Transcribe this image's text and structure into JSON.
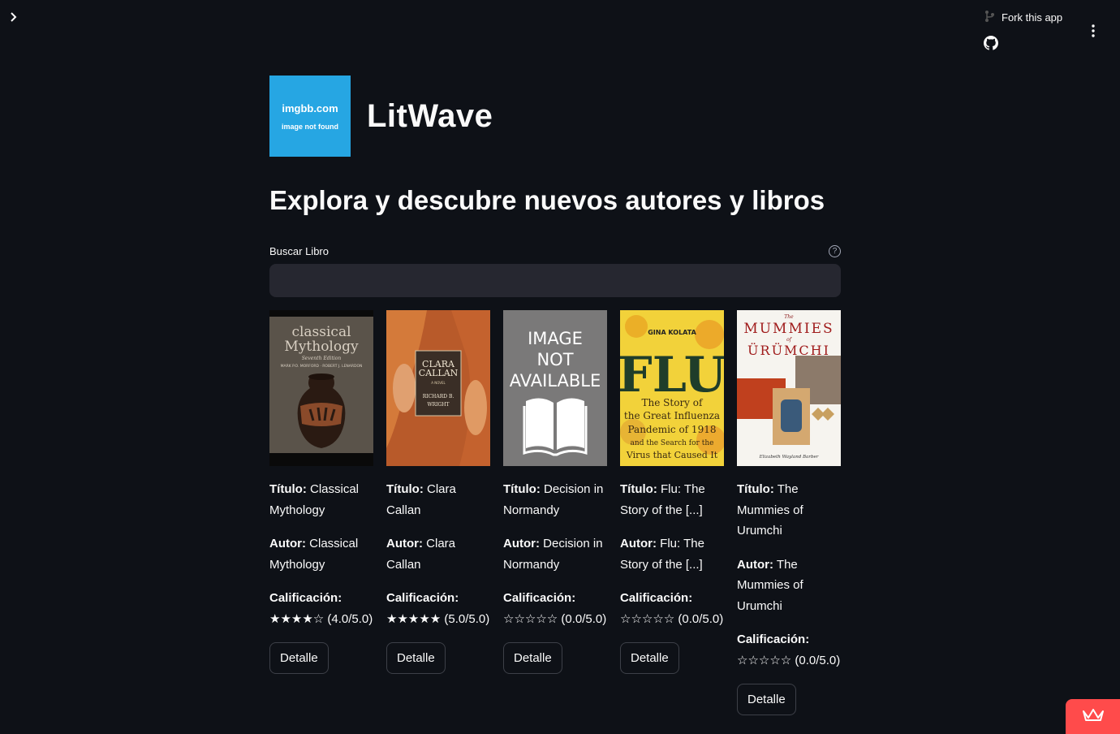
{
  "header": {
    "fork_label": "Fork this app"
  },
  "logo": {
    "line1": "imgbb.com",
    "line2": "image not found"
  },
  "app_title": "LitWave",
  "subtitle": "Explora y descubre nuevos autores y libros",
  "search": {
    "label": "Buscar Libro",
    "value": "",
    "placeholder": ""
  },
  "labels": {
    "title": "Título:",
    "author": "Autor:",
    "rating": "Calificación:",
    "detail": "Detalle"
  },
  "books": [
    {
      "title": "Classical Mythology",
      "author": "Classical Mythology",
      "rating_text": "★★★★☆ (4.0/5.0)",
      "rating": 4.0,
      "cover_text": [
        "classical",
        "Mythology",
        "Seventh Edition",
        "MARK P.O. MORFORD · ROBERT J. LENARDON"
      ]
    },
    {
      "title": "Clara Callan",
      "author": "Clara Callan",
      "rating_text": "★★★★★ (5.0/5.0)",
      "rating": 5.0,
      "cover_text": [
        "CLARA",
        "CALLAN",
        "A NOVEL",
        "RICHARD B.",
        "WRIGHT"
      ]
    },
    {
      "title": "Decision in Normandy",
      "author": "Decision in Normandy",
      "rating_text": "☆☆☆☆☆ (0.0/5.0)",
      "rating": 0.0,
      "cover_text": [
        "IMAGE",
        "NOT",
        "AVAILABLE"
      ]
    },
    {
      "title": "Flu: The Story of the [...]",
      "author": "Flu: The Story of the [...]",
      "rating_text": "☆☆☆☆☆ (0.0/5.0)",
      "rating": 0.0,
      "cover_text": [
        "GINA KOLATA",
        "FLU",
        "The Story of",
        "the Great Influenza",
        "Pandemic of 1918",
        "and the Search for the",
        "Virus that Caused It"
      ]
    },
    {
      "title": "The Mummies of Urumchi",
      "author": "The Mummies of Urumchi",
      "rating_text": "☆☆☆☆☆ (0.0/5.0)",
      "rating": 0.0,
      "cover_text": [
        "The",
        "MUMMIES",
        "of",
        "ÜRÜMCHI",
        "Elizabeth Wayland Barber"
      ]
    }
  ],
  "colors": {
    "background": "#0e1117",
    "input_bg": "#262730",
    "accent": "#ff4b4b",
    "logo_bg": "#26a6e3"
  }
}
